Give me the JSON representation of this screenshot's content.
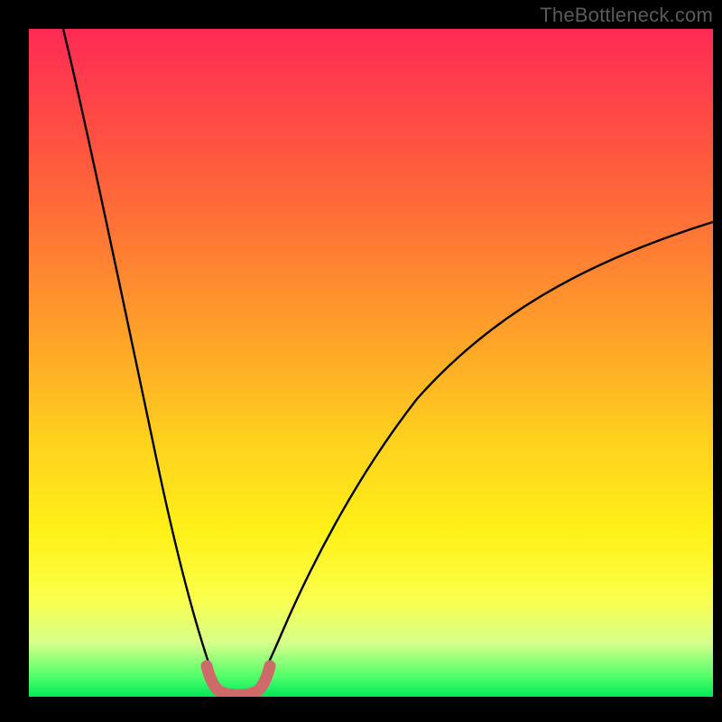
{
  "watermark": {
    "text": "TheBottleneck.com"
  },
  "chart_data": {
    "type": "line",
    "title": "",
    "xlabel": "",
    "ylabel": "",
    "xlim": [
      0,
      100
    ],
    "ylim": [
      0,
      100
    ],
    "grid": false,
    "series": [
      {
        "name": "bottleneck-curve-left",
        "x": [
          0,
          3,
          6,
          9,
          12,
          15,
          18,
          21,
          23.5,
          25.5,
          27,
          28
        ],
        "values": [
          100,
          89,
          78,
          67,
          56,
          45,
          34,
          22,
          11,
          4,
          1,
          0
        ]
      },
      {
        "name": "bottleneck-curve-right",
        "x": [
          32,
          34,
          36,
          40,
          45,
          50,
          56,
          63,
          71,
          80,
          90,
          100
        ],
        "values": [
          0,
          4,
          9,
          18,
          28,
          36,
          44,
          51,
          57,
          62,
          67,
          71
        ]
      },
      {
        "name": "trough-marker",
        "x": [
          25.5,
          26.5,
          27.5,
          28,
          29,
          30,
          31,
          32,
          33,
          34
        ],
        "values": [
          5,
          3,
          1.5,
          0.8,
          0.6,
          0.6,
          0.8,
          1.5,
          3,
          5
        ]
      }
    ],
    "background_gradient_stops": [
      {
        "pos": 0,
        "color": "#ff2a55"
      },
      {
        "pos": 50,
        "color": "#ffc81e"
      },
      {
        "pos": 85,
        "color": "#fbff4a"
      },
      {
        "pos": 100,
        "color": "#00e85c"
      }
    ]
  }
}
